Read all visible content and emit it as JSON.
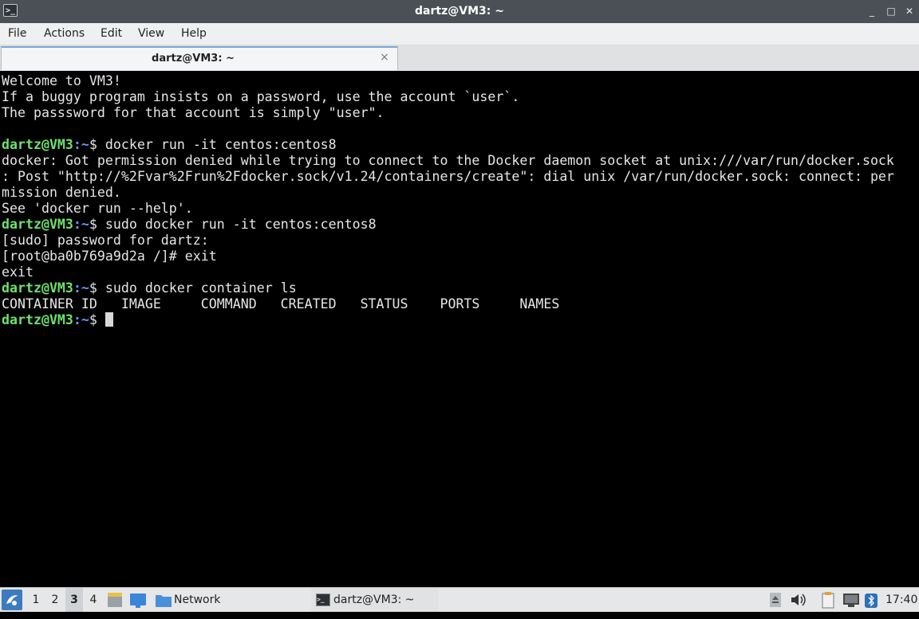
{
  "window": {
    "title": "dartz@VM3: ~",
    "app_icon_glyph": ">_",
    "buttons": {
      "minimize": "_",
      "maximize": "□",
      "close": "✕"
    }
  },
  "menubar": {
    "file": "File",
    "actions": "Actions",
    "edit": "Edit",
    "view": "View",
    "help": "Help"
  },
  "tabs": [
    {
      "label": "dartz@VM3: ~",
      "close": "×"
    }
  ],
  "terminal": {
    "colors": {
      "background": "#000000",
      "text": "#e6e6e6",
      "prompt_user": "#6fe06f",
      "prompt_path": "#6f95ff"
    },
    "prompt": {
      "user": "dartz@VM3",
      "sep": ":",
      "path": "~",
      "symbol": "$"
    },
    "lines": [
      "Welcome to VM3!",
      "If a buggy program insists on a password, use the account `user`.",
      "The passsword for that account is simply \"user\".",
      "",
      "docker run -it centos:centos8",
      "docker: Got permission denied while trying to connect to the Docker daemon socket at unix:///var/run/docker.sock",
      ": Post \"http://%2Fvar%2Frun%2Fdocker.sock/v1.24/containers/create\": dial unix /var/run/docker.sock: connect: per",
      "mission denied.",
      "See 'docker run --help'.",
      "sudo docker run -it centos:centos8",
      "[sudo] password for dartz:",
      "[root@ba0b769a9d2a /]# exit",
      "exit",
      "sudo docker container ls",
      "CONTAINER ID   IMAGE     COMMAND   CREATED   STATUS    PORTS     NAMES",
      ""
    ]
  },
  "taskbar": {
    "workspaces": [
      "1",
      "2",
      "3",
      "4"
    ],
    "active_workspace": "3",
    "network_folder": "Network",
    "task": "dartz@VM3: ~",
    "clock": "17:40"
  }
}
